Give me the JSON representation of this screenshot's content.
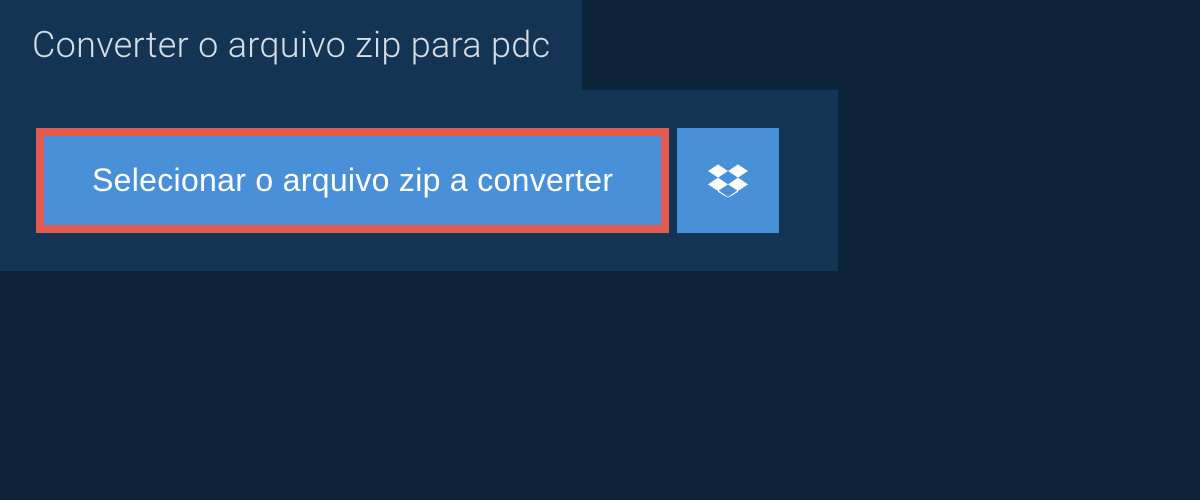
{
  "header": {
    "tab_label": "Converter o arquivo zip para pdc"
  },
  "actions": {
    "select_file_label": "Selecionar o arquivo zip a converter",
    "dropbox_icon": "dropbox-icon"
  },
  "colors": {
    "background": "#0d2438",
    "panel": "#133452",
    "primary_button": "#4a90d9",
    "highlight_border": "#e35a4f",
    "text_light": "#d5dde5",
    "text_white": "#ffffff"
  }
}
